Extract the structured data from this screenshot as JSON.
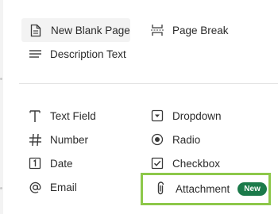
{
  "menu": {
    "page_items": [
      {
        "label": "New Blank Page",
        "icon": "page-icon"
      },
      {
        "label": "Page Break",
        "icon": "page-break-icon"
      },
      {
        "label": "Description Text",
        "icon": "description-text-icon"
      }
    ],
    "field_items": [
      {
        "label": "Text Field",
        "icon": "text-field-icon"
      },
      {
        "label": "Dropdown",
        "icon": "dropdown-icon"
      },
      {
        "label": "Number",
        "icon": "number-icon"
      },
      {
        "label": "Radio",
        "icon": "radio-icon"
      },
      {
        "label": "Date",
        "icon": "date-icon"
      },
      {
        "label": "Checkbox",
        "icon": "checkbox-icon"
      },
      {
        "label": "Email",
        "icon": "email-icon"
      },
      {
        "label": "Attachment",
        "icon": "attachment-icon",
        "badge": "New"
      }
    ]
  },
  "colors": {
    "badge_bg": "#1b7a4a",
    "highlight_border": "#8dc84a",
    "text": "#2b2b2b"
  }
}
